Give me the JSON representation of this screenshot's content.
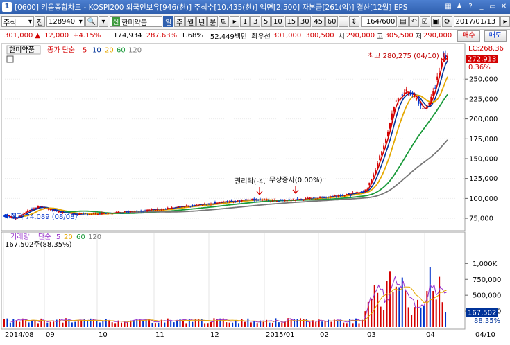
{
  "window": {
    "number": "1",
    "title": "[0600] 키움종합차트 - KOSPI200 외국인보유[946(천)] 주식수[10,435(천)] 액면[2,500] 자본금[261(억)] 결산[12월] EPS"
  },
  "toolbar": {
    "market": "주식",
    "market_btn": "전",
    "code": "128940",
    "stock_badge": "신",
    "stock_name": "한미약품",
    "periods": [
      "일",
      "주",
      "월",
      "년",
      "분",
      "틱"
    ],
    "active_period": "일",
    "minute_values": [
      "1",
      "3",
      "5",
      "10",
      "15",
      "30",
      "45",
      "60"
    ],
    "count": "164",
    "count_total": "/600",
    "date": "2017/01/13"
  },
  "quote": {
    "price": "301,000",
    "change": "12,000",
    "change_pct": "+4.15%",
    "volume": "174,934",
    "volume_ratio": "287.63%",
    "turnover": "1.68%",
    "amount": "52,449백만",
    "best_ask_label": "최우선",
    "best_ask": "301,000",
    "best_bid": "300,500",
    "open_label": "시",
    "open": "290,000",
    "high_label": "고",
    "high": "305,500",
    "low_label": "저",
    "low": "290,000",
    "buy_label": "매수",
    "sell_label": "매도"
  },
  "price_panel": {
    "stock_label": "한미약품",
    "title": "종가 단순",
    "ma_periods": [
      "5",
      "10",
      "20",
      "60",
      "120"
    ],
    "ma_colors": [
      "#d40000",
      "#003399",
      "#e5a800",
      "#1a9a3a",
      "#777777"
    ],
    "high_annotation": "최고 280,275 (04/10)",
    "low_annotation": "최저 74,089 (08/08)",
    "event1": "권리락(-4.",
    "event2": "무상증자(0.00%)",
    "lc_label": "LC:268.36",
    "price_tag": "272,913",
    "pct_tag": "0.36%",
    "y_ticks": [
      "250,000",
      "225,000",
      "200,000",
      "175,000",
      "150,000",
      "125,000",
      "100,000",
      "75,000"
    ],
    "ylim": [
      62000,
      292000
    ]
  },
  "volume_panel": {
    "title": "거래량",
    "ma_label": "단순",
    "ma_periods": [
      "5",
      "20",
      "60",
      "120"
    ],
    "ma_colors": [
      "#9933cc",
      "#e5a800",
      "#1a9a3a",
      "#777777"
    ],
    "current": "167,502주(88.35%)",
    "vol_tag": "167,502",
    "pct_tag": "88.35%",
    "y_ticks": [
      "1,000K",
      "750,000",
      "500,000",
      "250,000"
    ],
    "ylim": [
      0,
      1200000
    ]
  },
  "x_axis": {
    "labels": [
      "2014/08",
      "09",
      "10",
      "11",
      "12",
      "2015/01",
      "02",
      "03",
      "04",
      "04/10"
    ]
  },
  "chart_data": {
    "type": "candlestick",
    "x_range": [
      "2014/08",
      "2015/04/10"
    ],
    "close_approx": [
      {
        "date": "2014/08",
        "value": 80000
      },
      {
        "date": "2014/08/08",
        "value": 74089
      },
      {
        "date": "2014/09",
        "value": 90000
      },
      {
        "date": "2014/10",
        "value": 80000
      },
      {
        "date": "2014/11",
        "value": 83000
      },
      {
        "date": "2014/12",
        "value": 87000
      },
      {
        "date": "2015/01",
        "value": 98000
      },
      {
        "date": "2015/02",
        "value": 100000
      },
      {
        "date": "2015/03",
        "value": 110000
      },
      {
        "date": "2015/03 late",
        "value": 230000
      },
      {
        "date": "2015/04",
        "value": 215000
      },
      {
        "date": "2015/04/10",
        "value": 280275
      }
    ],
    "volume_peak_approx": 1150000
  }
}
